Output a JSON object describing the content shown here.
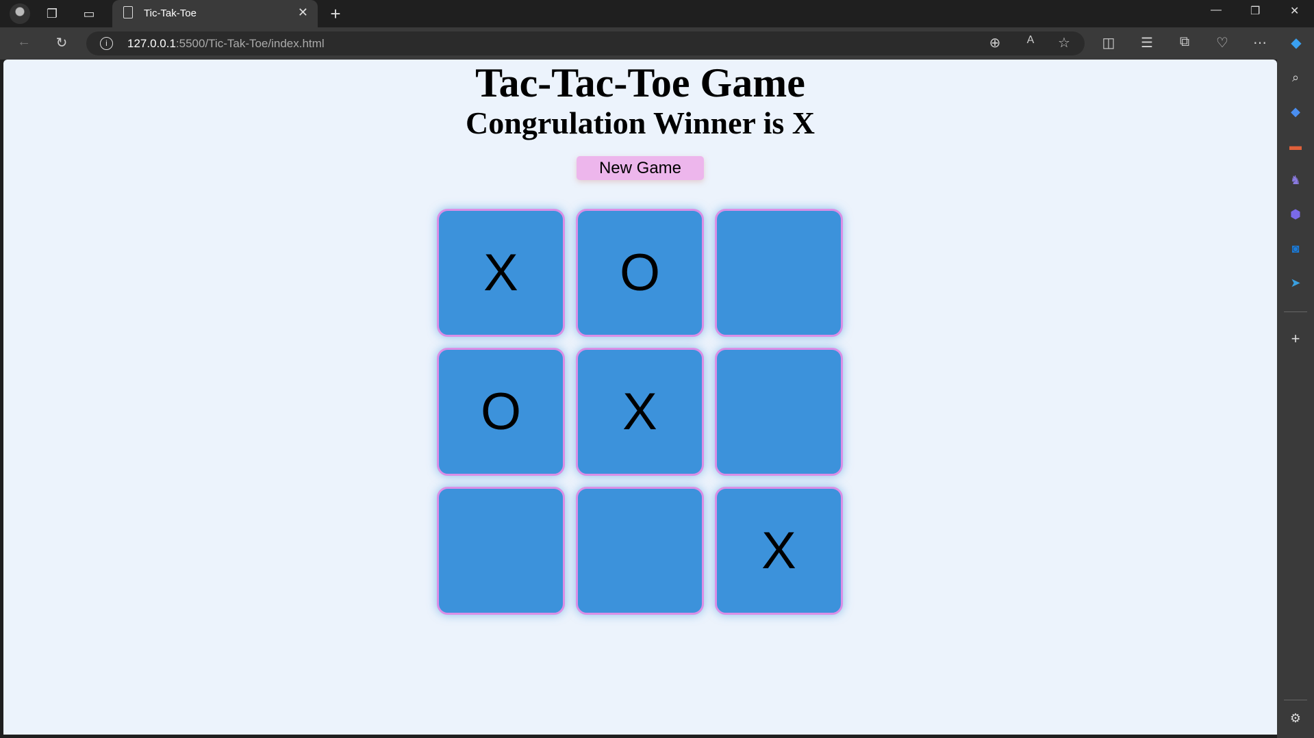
{
  "browser": {
    "tab_title": "Tic-Tak-Toe",
    "url_host": "127.0.0.1",
    "url_rest": ":5500/Tic-Tak-Toe/index.html"
  },
  "page": {
    "title": "Tac-Tac-Toe Game",
    "message": "Congrulation Winner is X",
    "new_game_label": "New Game",
    "board": [
      "X",
      "O",
      "",
      "O",
      "X",
      "",
      "",
      "",
      "X"
    ]
  },
  "colors": {
    "cell": "#3c92db",
    "cell_border": "#da8fe6",
    "button": "#edb6ec",
    "page_bg": "#ecf3fc"
  }
}
